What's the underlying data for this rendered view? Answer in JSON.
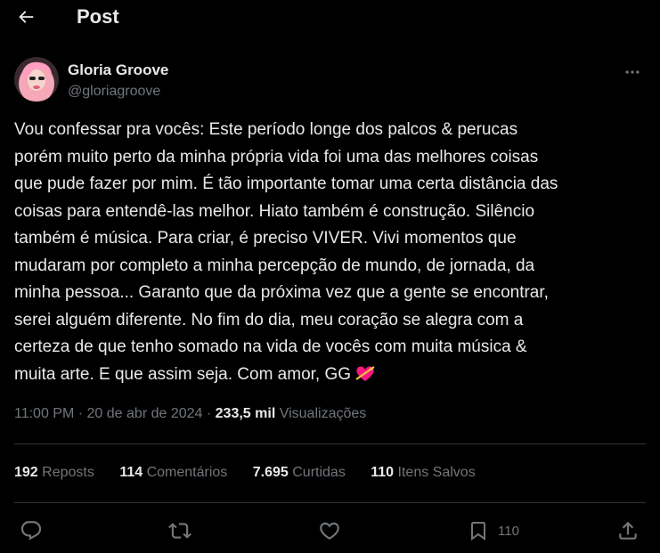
{
  "header": {
    "title": "Post"
  },
  "author": {
    "name": "Gloria Groove",
    "handle": "@gloriagroove"
  },
  "tweet": {
    "text": "Vou confessar pra vocês: Este período longe dos palcos & perucas\nporém muito perto da minha própria vida foi uma das melhores coisas\nque pude fazer por mim. É tão importante tomar uma certa distância das\ncoisas para entendê-las melhor. Hiato também é construção. Silêncio\ntambém é música. Para criar, é preciso VIVER. Vivi momentos que\nmudaram por completo a minha percepção de mundo, de jornada, da\nminha pessoa... Garanto que da próxima vez que a gente se encontrar,\nserei alguém diferente. No fim do dia, meu coração se alegra com a\ncerteza de que tenho somado na vida de vocês com muita música &\nmuita arte. E que assim seja. Com amor, GG",
    "emoji": "heart-with-arrow-icon"
  },
  "meta": {
    "time": "11:00 PM",
    "sep1": "·",
    "date": "20 de abr de 2024",
    "sep2": "·",
    "views_count": "233,5 mil",
    "views_label": "Visualizações"
  },
  "stats": {
    "reposts_count": "192",
    "reposts_label": "Reposts",
    "comments_count": "114",
    "comments_label": "Comentários",
    "likes_count": "7.695",
    "likes_label": "Curtidas",
    "saves_count": "110",
    "saves_label": "Itens Salvos"
  },
  "actions": {
    "bookmark_count": "110"
  },
  "colors": {
    "background": "#000000",
    "text": "#e7e9ea",
    "secondary": "#71767b",
    "divider": "#2f3336",
    "heart": "#f91880"
  }
}
